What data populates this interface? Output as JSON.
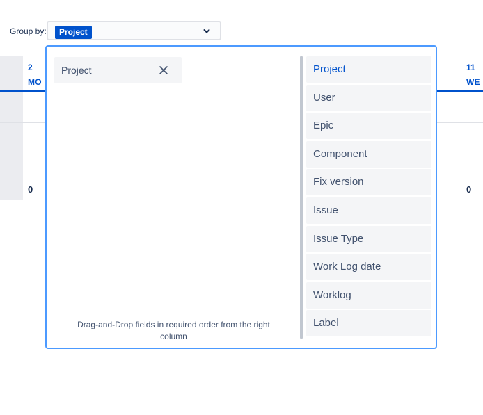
{
  "group_by": {
    "label": "Group by:",
    "selected_tag": "Project"
  },
  "table_bg": {
    "left_day": {
      "num": "2",
      "name": "MO",
      "total": "0"
    },
    "right_day": {
      "num": "11",
      "name": "WE",
      "total": "0"
    }
  },
  "popup": {
    "selected_fields": [
      {
        "label": "Project"
      }
    ],
    "hint": "Drag-and-Drop fields in required order from the right column",
    "available_fields": [
      {
        "label": "Project",
        "active": true
      },
      {
        "label": "User"
      },
      {
        "label": "Epic"
      },
      {
        "label": "Component"
      },
      {
        "label": "Fix version"
      },
      {
        "label": "Issue"
      },
      {
        "label": "Issue Type"
      },
      {
        "label": "Work Log date"
      },
      {
        "label": "Worklog"
      },
      {
        "label": "Label"
      }
    ]
  },
  "colors": {
    "accent": "#0052cc",
    "focus_border": "#4c9aff",
    "item_bg": "#f4f5f7"
  }
}
